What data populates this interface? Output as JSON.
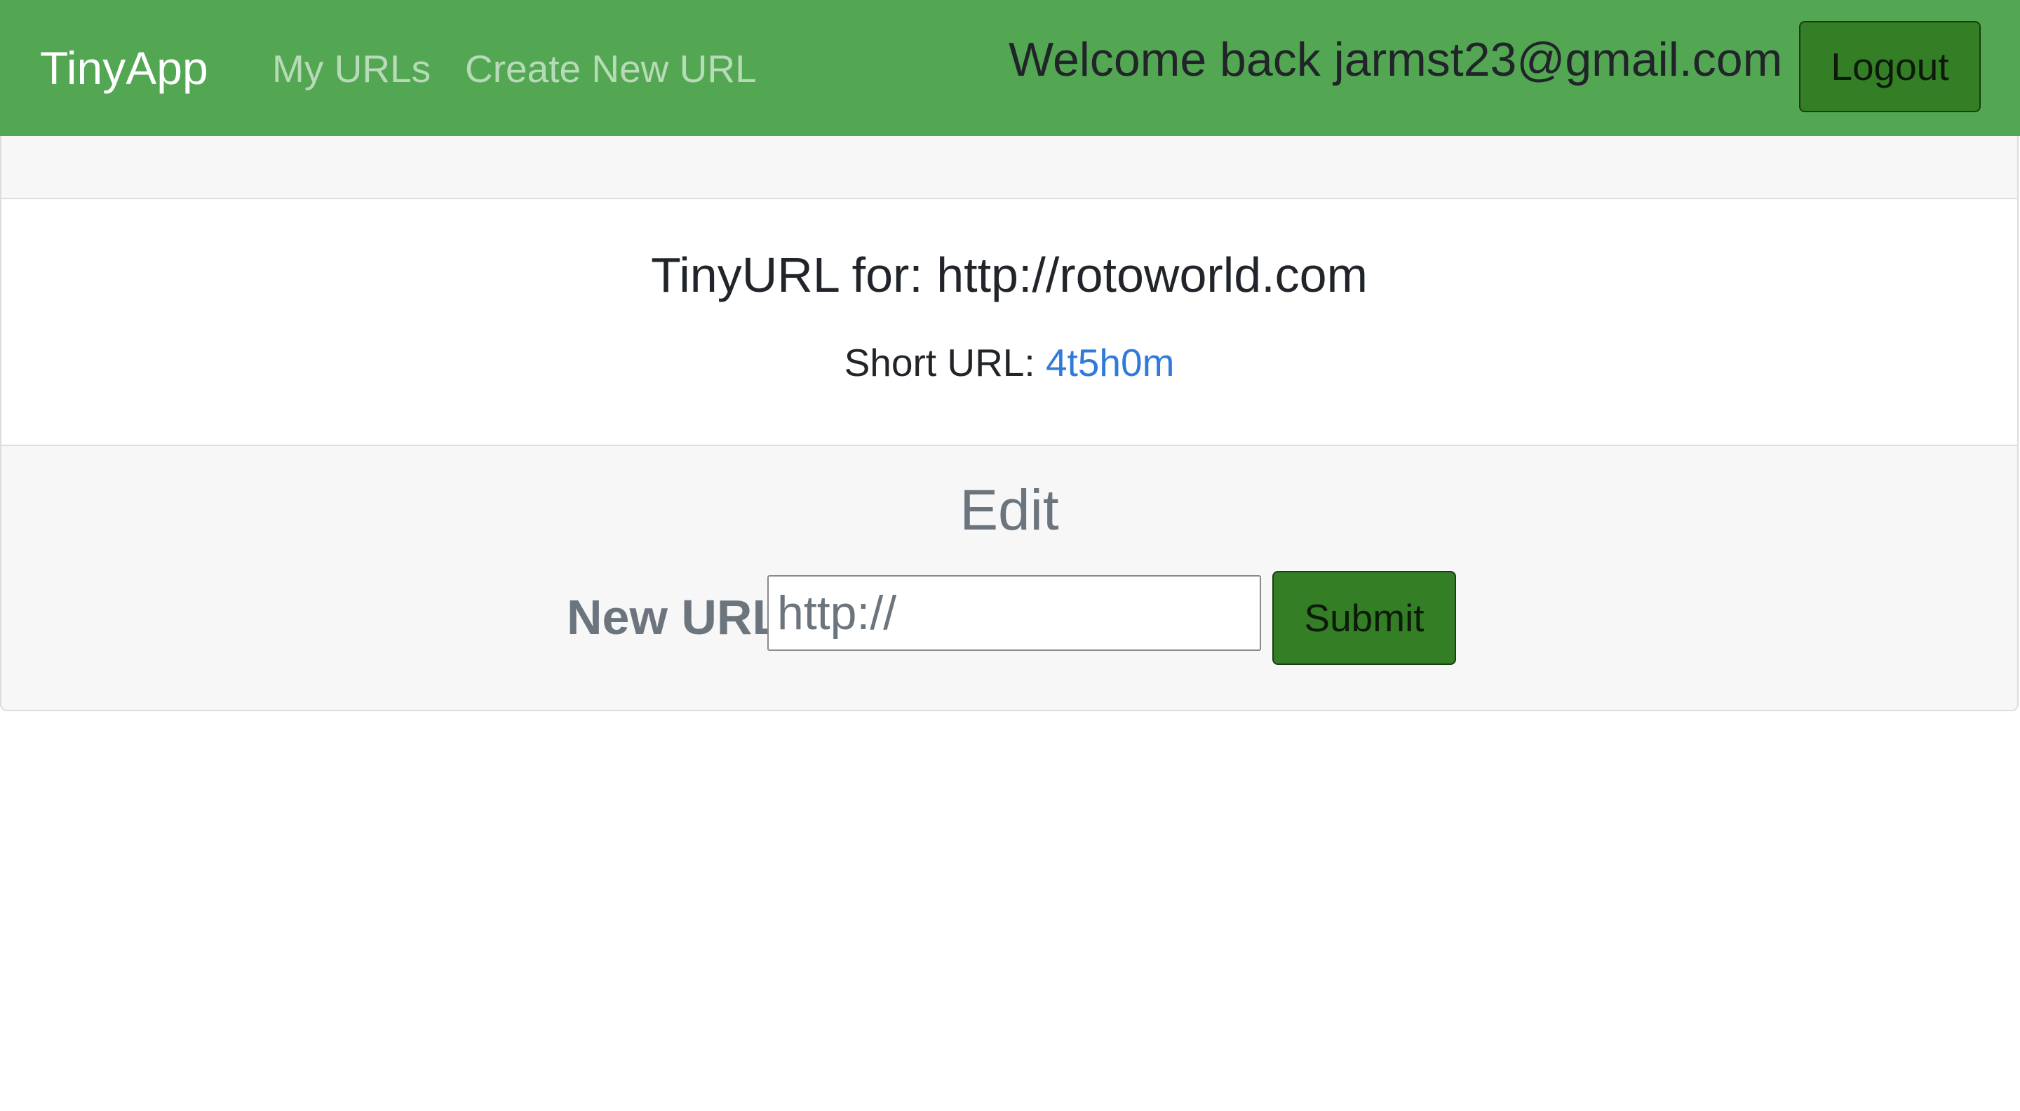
{
  "navbar": {
    "brand": "TinyApp",
    "links": {
      "my_urls": "My URLs",
      "create_url": "Create New URL"
    },
    "welcome": "Welcome back jarmst23@gmail.com",
    "logout_label": "Logout",
    "background_color": "#53a753"
  },
  "card": {
    "title": "TinyURL for: http://rotoworld.com",
    "short_url_label": "Short URL: ",
    "short_url_value": "4t5h0m",
    "link_color": "#2f7bdc"
  },
  "edit": {
    "heading": "Edit",
    "new_url_label": "New URL",
    "input_placeholder": "http://",
    "input_value": "",
    "submit_label": "Submit",
    "button_color": "#347f25"
  }
}
